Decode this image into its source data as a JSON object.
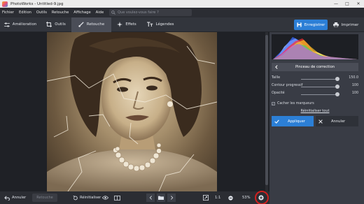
{
  "window": {
    "title": "PhotoWorks - Untitled-9.jpg"
  },
  "menu": {
    "items": [
      "Fichier",
      "Edition",
      "Outils",
      "Retouche",
      "Affichage",
      "Aide"
    ],
    "search_placeholder": "Que voulez-vous faire ?"
  },
  "toolbar": {
    "tabs": [
      {
        "label": "Amélioration",
        "icon": "sliders-icon"
      },
      {
        "label": "Outils",
        "icon": "crop-icon"
      },
      {
        "label": "Retouche",
        "icon": "brush-icon",
        "active": true
      },
      {
        "label": "Effets",
        "icon": "sparkle-icon"
      },
      {
        "label": "Légendes",
        "icon": "text-icon"
      }
    ],
    "save_label": "Enregistrer",
    "print_label": "Imprimer"
  },
  "panel": {
    "title": "Pinceau de correction",
    "sliders": [
      {
        "label": "Taille",
        "value": "150.0",
        "level": 1.0
      },
      {
        "label": "Contour progressif",
        "value": "100",
        "level": 1.0
      },
      {
        "label": "Opacité",
        "value": "100",
        "level": 1.0
      }
    ],
    "hide_markers_label": "Cacher les marqueurs",
    "hide_markers_checked": true,
    "reset_all_label": "Réinitialiser tout",
    "apply_label": "Appliquer",
    "cancel_label": "Annuler"
  },
  "bottombar": {
    "undo_label": "Annuler",
    "retouch_label": "Retouche",
    "reset_label": "Réinitialiser",
    "ratio_label": "1:1",
    "zoom_label": "53%"
  },
  "colors": {
    "accent": "#2c7fd6",
    "highlight_ring": "#d0201f",
    "panel_bg": "#393c45",
    "app_bg": "#2b2d33"
  }
}
